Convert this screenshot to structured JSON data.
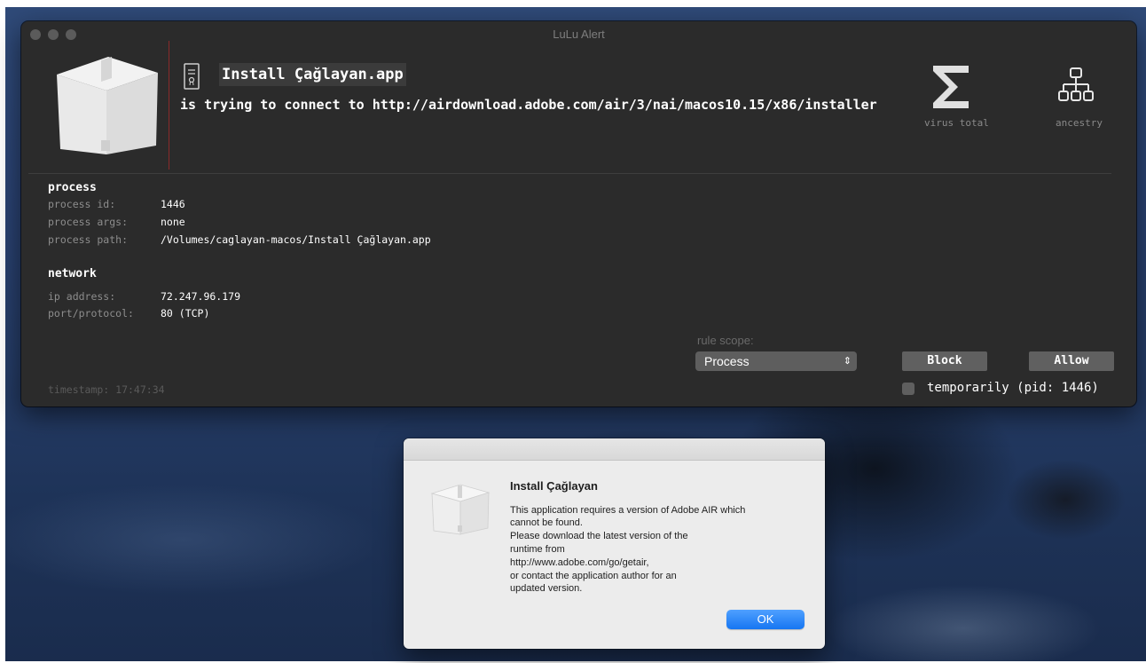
{
  "lulu_alert": {
    "window_title": "LuLu Alert",
    "app_name": "Install Çağlayan.app",
    "connection_text": "is trying to connect to http://airdownload.adobe.com/air/3/nai/macos10.15/x86/installer",
    "virus_total_label": "virus total",
    "ancestry_label": "ancestry",
    "process": {
      "heading": "process",
      "id_key": "process id:",
      "id_value": "1446",
      "args_key": "process args:",
      "args_value": "none",
      "path_key": "process path:",
      "path_value": "/Volumes/caglayan-macos/Install Çağlayan.app"
    },
    "network": {
      "heading": "network",
      "ip_key": "ip address:",
      "ip_value": "72.247.96.179",
      "port_key": "port/protocol:",
      "port_value": "80 (TCP)"
    },
    "rule_scope_label": "rule scope:",
    "rule_scope_value": "Process",
    "block_label": "Block",
    "allow_label": "Allow",
    "temporarily_label": "temporarily (pid: 1446)",
    "temporarily_checked": false,
    "timestamp": "timestamp: 17:47:34"
  },
  "dialog": {
    "title": "Install Çağlayan",
    "message_lines": [
      "This application requires a version of Adobe AIR which",
      "cannot be found.",
      "Please download the latest version of the",
      "runtime from",
      "http://www.adobe.com/go/getair,",
      "or contact the application author for an",
      "updated version."
    ],
    "ok_label": "OK",
    "accent_color": "#1676f2"
  }
}
